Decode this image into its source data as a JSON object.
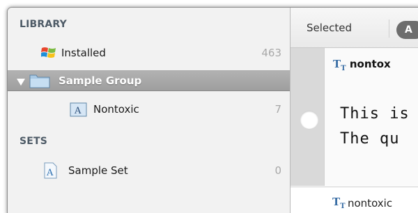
{
  "sidebar": {
    "library_heading": "LIBRARY",
    "sets_heading": "SETS",
    "items": [
      {
        "label": "Installed",
        "count": "463",
        "icon": "windows-logo-icon"
      },
      {
        "label": "Sample Group",
        "count": "",
        "icon": "folder-icon"
      },
      {
        "label": "Nontoxic",
        "count": "7",
        "icon": "font-file-icon"
      }
    ],
    "sets": [
      {
        "label": "Sample Set",
        "count": "0",
        "icon": "font-set-icon"
      }
    ]
  },
  "toolbar": {
    "selected_label": "Selected",
    "pill_label": "A"
  },
  "preview": {
    "font_name": "nontox",
    "sample_line_1": "This is",
    "sample_line_2": "The qu",
    "next_font_name": "nontoxic"
  },
  "colors": {
    "selected_row": "#a8a8a8",
    "sidebar_bg": "#f2f2f2",
    "heading": "#4d5a66",
    "count": "#a8a8a8"
  }
}
